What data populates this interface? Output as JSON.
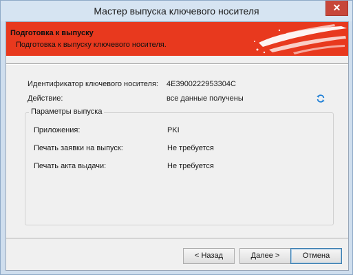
{
  "window": {
    "title": "Мастер выпуска ключевого носителя",
    "close_glyph": "✕"
  },
  "banner": {
    "title": "Подготовка к выпуску",
    "subtitle": "Подготовка к выпуску ключевого носителя.",
    "color": "#e8391e"
  },
  "details": {
    "id_label": "Идентификатор ключевого носителя:",
    "id_value": "4E3900222953304C",
    "action_label": "Действие:",
    "action_value": "все данные получены",
    "refresh_icon": "refresh-icon"
  },
  "params": {
    "title": "Параметры выпуска",
    "rows": [
      {
        "label": "Приложения:",
        "value": "PKI"
      },
      {
        "label": "Печать заявки на выпуск:",
        "value": "Не требуется"
      },
      {
        "label": "Печать акта выдачи:",
        "value": "Не требуется"
      }
    ]
  },
  "buttons": {
    "back": "< Назад",
    "next": "Далее >",
    "cancel": "Отмена"
  }
}
